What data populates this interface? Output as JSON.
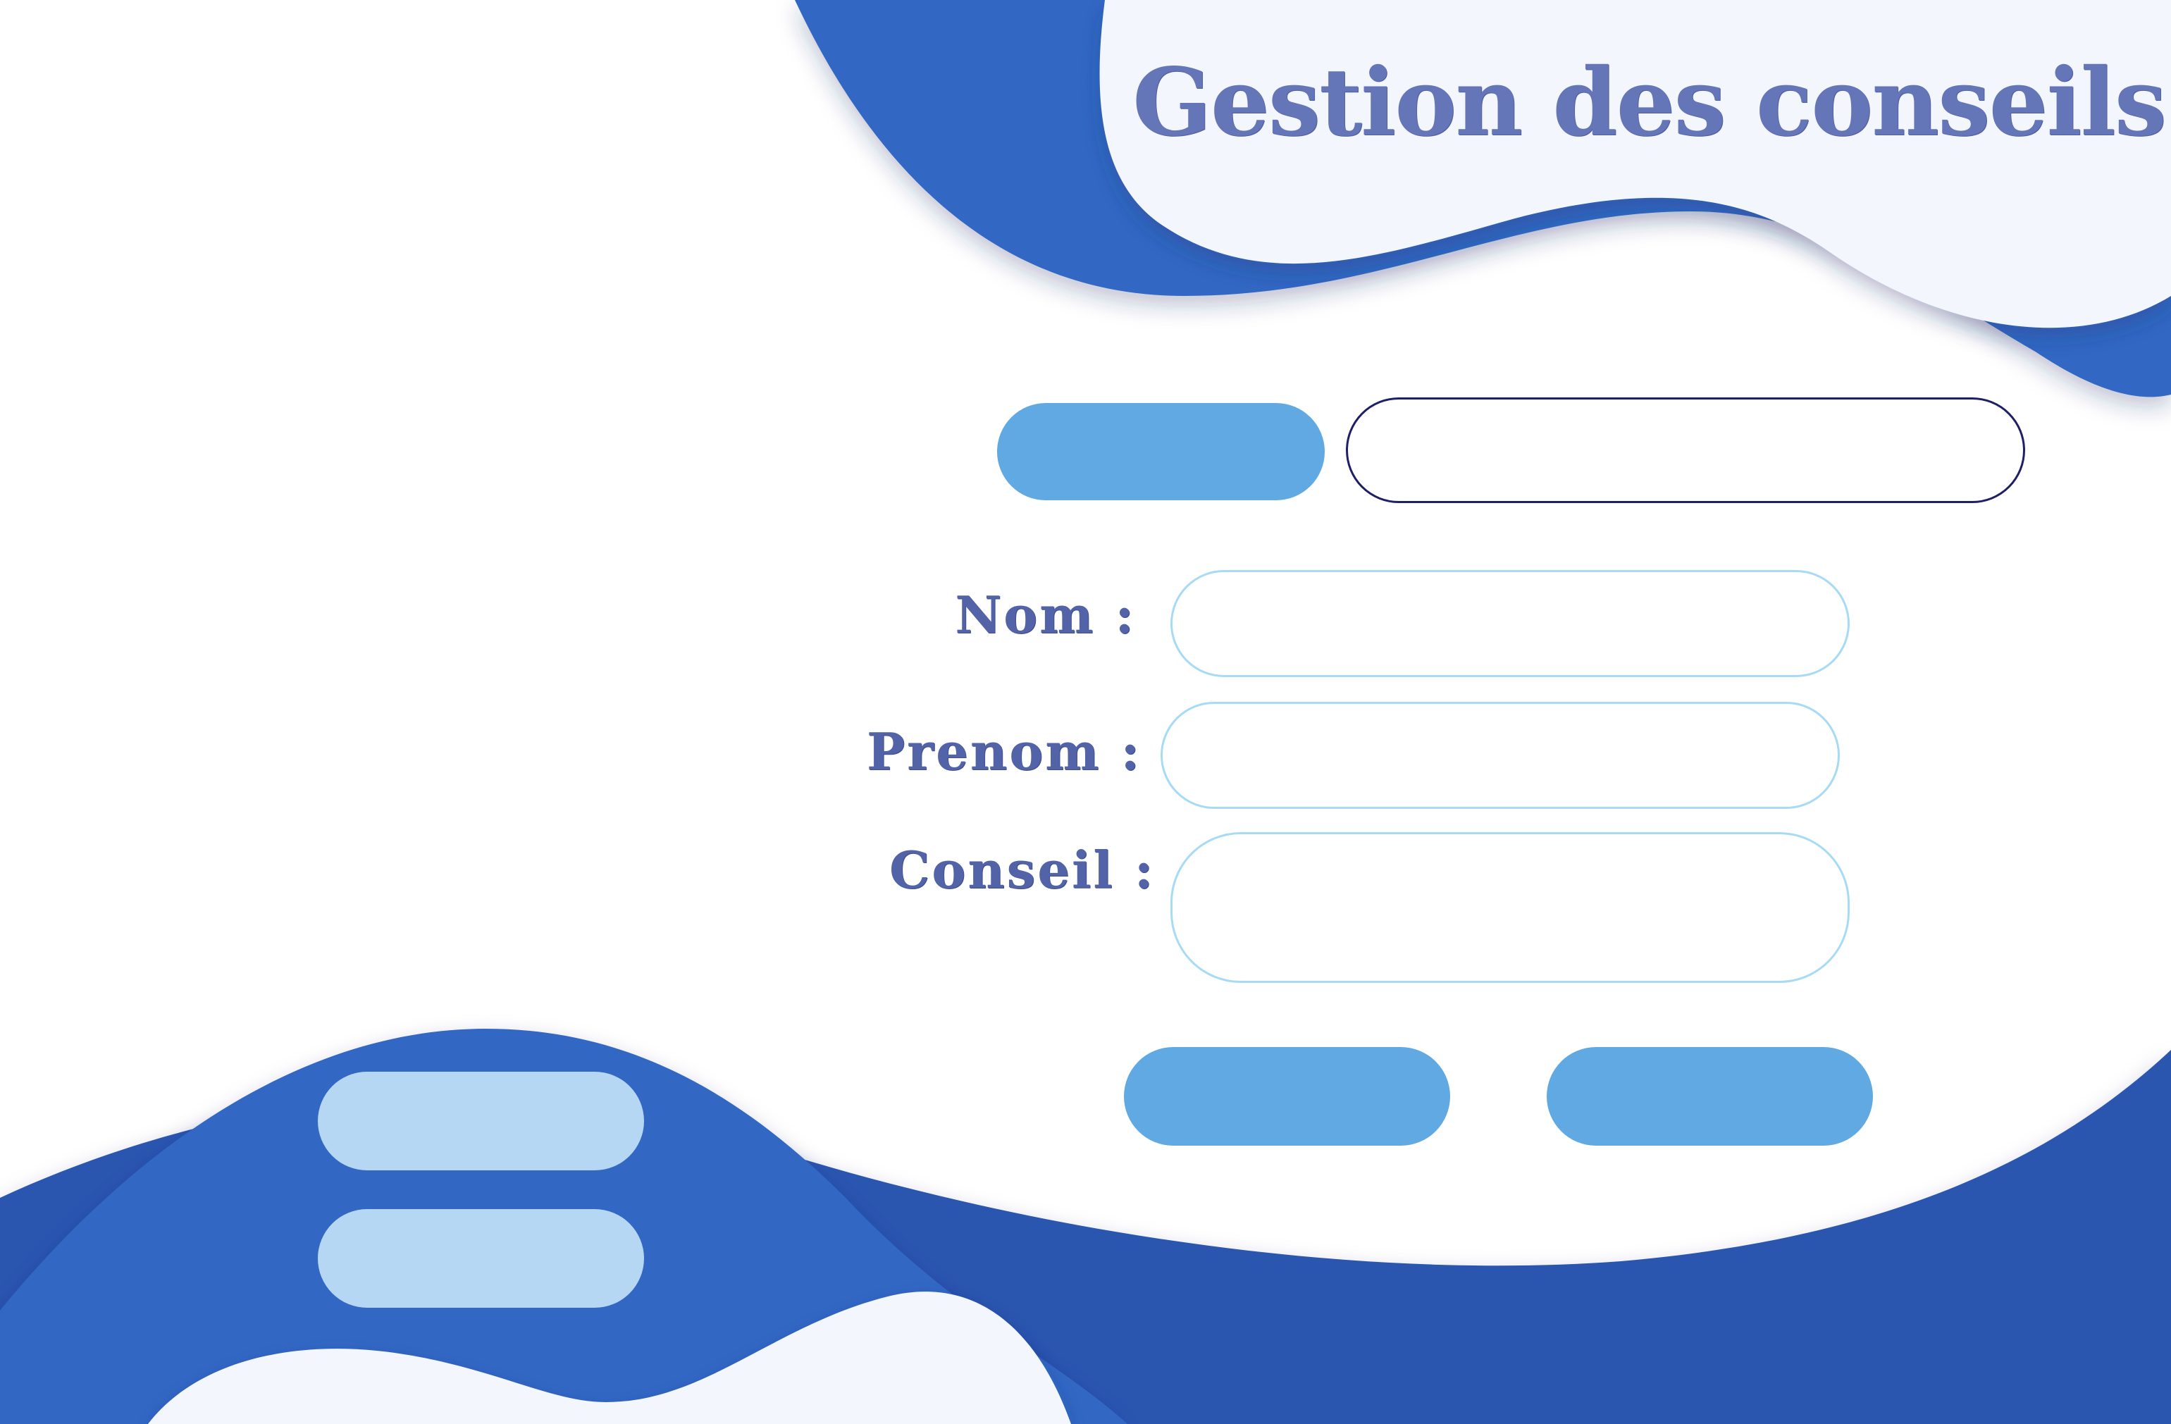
{
  "app": {
    "title": "Gestion des conseils"
  },
  "search": {
    "button_label": "",
    "input_value": "",
    "input_placeholder": ""
  },
  "form": {
    "nom_label": "Nom :",
    "nom_value": "",
    "prenom_label": "Prenom :",
    "prenom_value": "",
    "conseil_label": "Conseil :",
    "conseil_value": ""
  },
  "actions": {
    "primary_label": "",
    "secondary_label": ""
  },
  "sidebar": {
    "item1_label": "",
    "item2_label": ""
  },
  "colors": {
    "background": "#ffffff",
    "wave_dark": "#2b57b0",
    "wave_mid": "#3167c4",
    "wave_light": "#f3f7fd",
    "title_text": "#6576b8",
    "label_text": "#5263a8",
    "button_primary": "#61a9e3",
    "button_side": "#b5d7f3",
    "field_border": "#a6daf5",
    "search_border": "#1f1f66"
  }
}
